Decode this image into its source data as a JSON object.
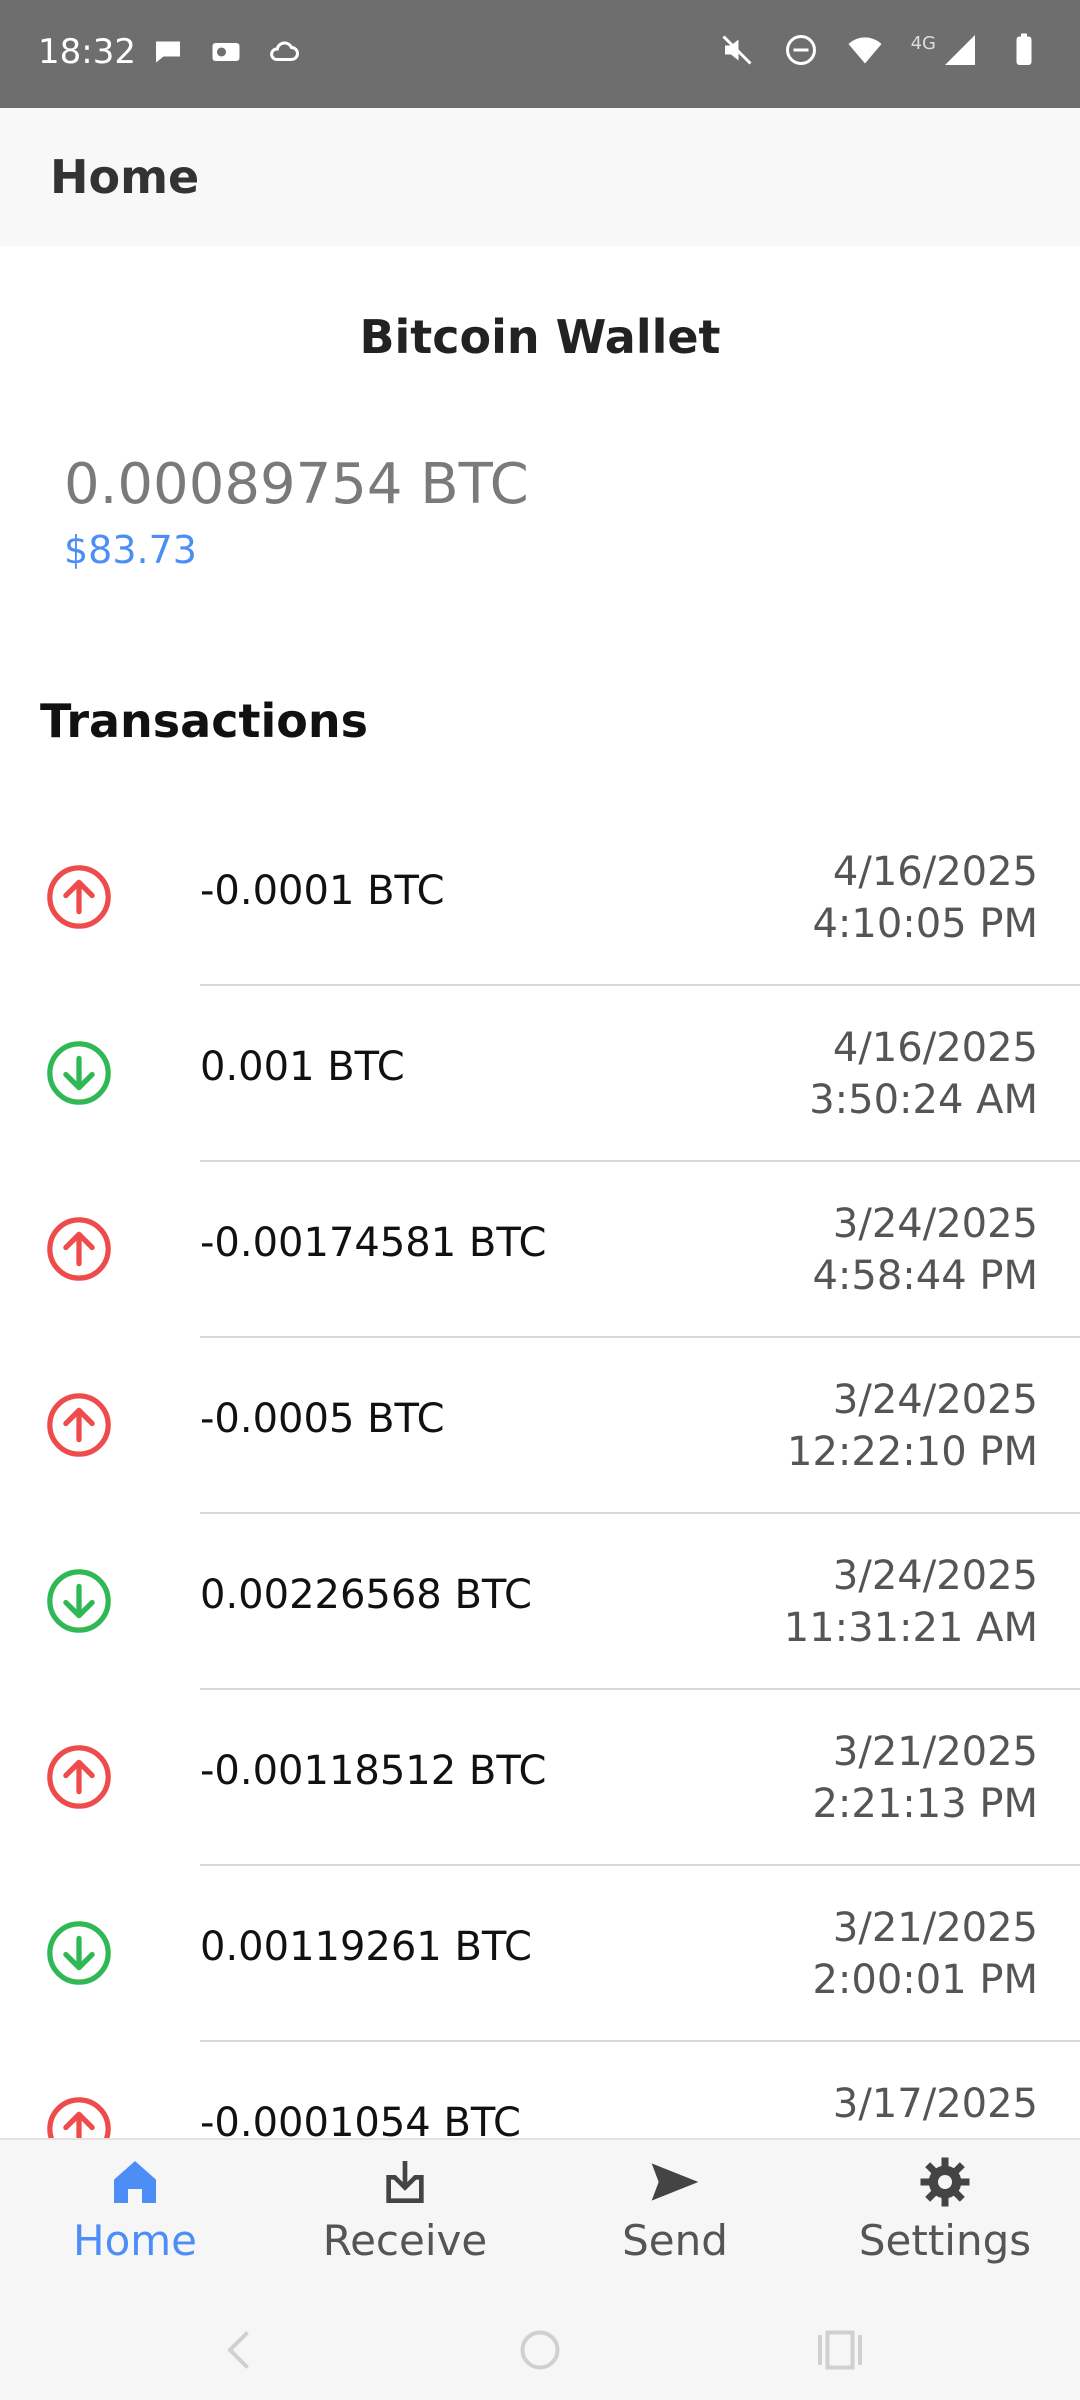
{
  "status_bar": {
    "time": "18:32",
    "network": "4G"
  },
  "app_bar": {
    "title": "Home"
  },
  "wallet": {
    "title": "Bitcoin Wallet",
    "balance_btc": "0.00089754 BTC",
    "balance_usd": "$83.73"
  },
  "transactions_title": "Transactions",
  "transactions": [
    {
      "direction": "out",
      "amount": "-0.0001 BTC",
      "date": "4/16/2025",
      "time": "4:10:05 PM"
    },
    {
      "direction": "in",
      "amount": "0.001 BTC",
      "date": "4/16/2025",
      "time": "3:50:24 AM"
    },
    {
      "direction": "out",
      "amount": "-0.00174581 BTC",
      "date": "3/24/2025",
      "time": "4:58:44 PM"
    },
    {
      "direction": "out",
      "amount": "-0.0005 BTC",
      "date": "3/24/2025",
      "time": "12:22:10 PM"
    },
    {
      "direction": "in",
      "amount": "0.00226568 BTC",
      "date": "3/24/2025",
      "time": "11:31:21 AM"
    },
    {
      "direction": "out",
      "amount": "-0.00118512 BTC",
      "date": "3/21/2025",
      "time": "2:21:13 PM"
    },
    {
      "direction": "in",
      "amount": "0.00119261 BTC",
      "date": "3/21/2025",
      "time": "2:00:01 PM"
    },
    {
      "direction": "out",
      "amount": "-0.0001054 BTC",
      "date": "3/17/2025",
      "time": ""
    }
  ],
  "colors": {
    "outgoing": "#ee4b4b",
    "incoming": "#2fb856",
    "accent": "#4d8ef6"
  },
  "nav": {
    "home": "Home",
    "receive": "Receive",
    "send": "Send",
    "settings": "Settings"
  }
}
